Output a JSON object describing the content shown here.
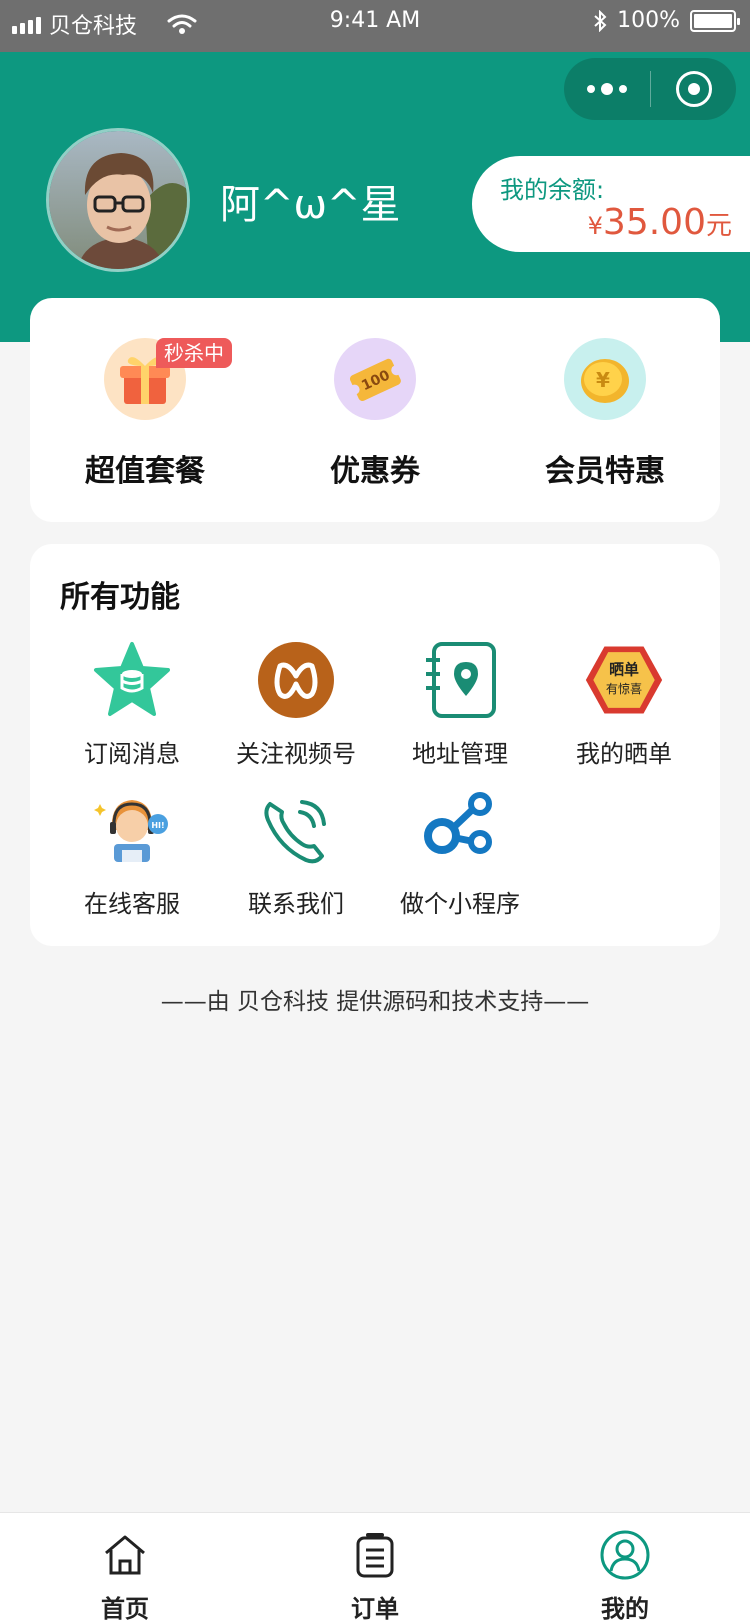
{
  "status_bar": {
    "carrier": "贝仓科技",
    "time": "9:41 AM",
    "battery": "100%"
  },
  "profile": {
    "username": "阿^ω^星"
  },
  "balance": {
    "label": "我的余额:",
    "currency": "¥",
    "amount": "35.00",
    "unit": "元"
  },
  "promos": [
    {
      "label": "超值套餐",
      "badge": "秒杀中",
      "icon": "gift-icon"
    },
    {
      "label": "优惠券",
      "icon": "coupon-icon"
    },
    {
      "label": "会员特惠",
      "icon": "coin-icon"
    }
  ],
  "features": {
    "title": "所有功能",
    "items": [
      {
        "label": "订阅消息",
        "icon": "star-database-icon"
      },
      {
        "label": "关注视频号",
        "icon": "video-channel-icon"
      },
      {
        "label": "地址管理",
        "icon": "address-book-icon"
      },
      {
        "label": "我的晒单",
        "icon": "share-order-badge-icon",
        "icon_text_top": "晒单",
        "icon_text_bottom": "有惊喜"
      },
      {
        "label": "在线客服",
        "icon": "customer-service-icon",
        "icon_text": "HI!"
      },
      {
        "label": "联系我们",
        "icon": "phone-icon"
      },
      {
        "label": "做个小程序",
        "icon": "mini-program-icon"
      }
    ]
  },
  "footer": {
    "text": "——由 贝仓科技 提供源码和技术支持——"
  },
  "tabbar": [
    {
      "label": "首页",
      "icon": "home-icon"
    },
    {
      "label": "订单",
      "icon": "order-icon"
    },
    {
      "label": "我的",
      "icon": "profile-icon",
      "active": true
    }
  ],
  "colors": {
    "primary": "#0d9880",
    "accent_price": "#e0583e",
    "badge": "#ee5a5a",
    "background": "#f5f5f5"
  }
}
